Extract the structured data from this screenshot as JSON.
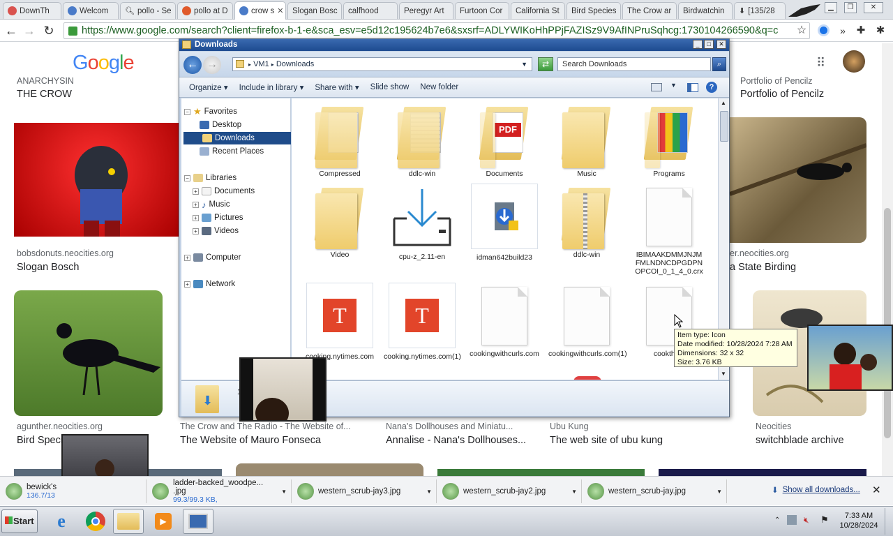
{
  "browser": {
    "tabs": [
      {
        "label": "DownTh",
        "color": "#d9534f"
      },
      {
        "label": "Welcom",
        "color": "#4a7bc8"
      },
      {
        "label": "pollo - Se",
        "color": "#4a7bc8"
      },
      {
        "label": "pollo at D",
        "color": "#e05a2b"
      },
      {
        "label": "crow s",
        "color": "#4a7bc8"
      },
      {
        "label": "Slogan Bosc",
        "color": ""
      },
      {
        "label": "calfhood",
        "color": ""
      },
      {
        "label": "Peregyr Art",
        "color": ""
      },
      {
        "label": "Furtoon Cor",
        "color": ""
      },
      {
        "label": "California St",
        "color": ""
      },
      {
        "label": "Bird Species",
        "color": ""
      },
      {
        "label": "The Crow ar",
        "color": ""
      },
      {
        "label": "Birdwatchin",
        "color": ""
      },
      {
        "label": "[135/28",
        "color": ""
      }
    ],
    "url": "https://www.google.com/search?client=firefox-b-1-e&sca_esv=e5d12c195624b7e6&sxsrf=ADLYWIKoHhPPjFAZISz9V9AfINPruSqhcg:1730104266590&q=c"
  },
  "google": {
    "logo": "Google",
    "results": [
      {
        "source": "ANARCHYSIN",
        "title": "THE CROW"
      },
      {
        "source": "Portfolio of Pencilz",
        "title": "Portfolio of Pencilz"
      },
      {
        "source": "bobsdonuts.neocities.org",
        "title": "Slogan Bosch"
      },
      {
        "source": "er.neocities.org",
        "title": "a State Birding"
      },
      {
        "source": "agunther.neocities.org",
        "title": "Bird Speci"
      },
      {
        "source": "The Crow and The Radio - The Website of...",
        "title": "The Website of Mauro Fonseca"
      },
      {
        "source": "Nana's Dollhouses and Miniatu...",
        "title": "Annalise - Nana's Dollhouses..."
      },
      {
        "source": "Ubu Kung",
        "title": "The web site of ubu kung"
      },
      {
        "source": "Neocities",
        "title": "switchblade archive"
      }
    ]
  },
  "explorer": {
    "title": "Downloads",
    "breadcrumb": [
      "VM1",
      "Downloads"
    ],
    "search_placeholder": "Search Downloads",
    "commands": [
      "Organize",
      "Include in library",
      "Share with",
      "Slide show",
      "New folder"
    ],
    "nav": {
      "favorites": "Favorites",
      "desktop": "Desktop",
      "downloads": "Downloads",
      "recent": "Recent Places",
      "libraries": "Libraries",
      "documents": "Documents",
      "music": "Music",
      "pictures": "Pictures",
      "videos": "Videos",
      "computer": "Computer",
      "network": "Network"
    },
    "files": [
      {
        "name": "Compressed",
        "kind": "folder"
      },
      {
        "name": "ddlc-win",
        "kind": "folder"
      },
      {
        "name": "Documents",
        "kind": "folder-pdf"
      },
      {
        "name": "Music",
        "kind": "folder"
      },
      {
        "name": "Programs",
        "kind": "folder-programs"
      },
      {
        "name": "Video",
        "kind": "folder"
      },
      {
        "name": "cpu-z_2.11-en",
        "kind": "download"
      },
      {
        "name": "idman642build23",
        "kind": "installer"
      },
      {
        "name": "ddlc-win",
        "kind": "zip-folder"
      },
      {
        "name": "IBIMAAKDMMJNJMFMLNDNCDPGDPNOPCOI_0_1_4_0.crx",
        "kind": "file"
      },
      {
        "name": "cooking.nytimes.com",
        "kind": "nyt"
      },
      {
        "name": "cooking.nytimes.com(1)",
        "kind": "nyt"
      },
      {
        "name": "cookingwithcurls.com",
        "kind": "file"
      },
      {
        "name": "cookingwithcurls.com(1)",
        "kind": "file"
      },
      {
        "name": "cookthink",
        "kind": "file"
      }
    ],
    "details_count": "1",
    "tooltip": {
      "type": "Item type: Icon",
      "modified": "Date modified: 10/28/2024 7:28 AM",
      "dimensions": "Dimensions: 32 x 32",
      "size": "Size: 3.76 KB"
    }
  },
  "downloads": {
    "items": [
      {
        "name": "bewick's",
        "status": "136.7/13"
      },
      {
        "name": "ladder-backed_woodpe... .jpg",
        "status": "99.3/99.3 KB,"
      },
      {
        "name": "western_scrub-jay3.jpg",
        "status": ""
      },
      {
        "name": "western_scrub-jay2.jpg",
        "status": ""
      },
      {
        "name": "western_scrub-jay.jpg",
        "status": ""
      }
    ],
    "show_all": "Show all downloads..."
  },
  "taskbar": {
    "start": "Start",
    "time": "7:33 AM",
    "date": "10/28/2024"
  },
  "icons": {
    "back": "back-arrow-icon",
    "forward": "forward-arrow-icon",
    "reload": "reload-icon",
    "star": "star-icon",
    "apps": "apps-grid-icon"
  }
}
